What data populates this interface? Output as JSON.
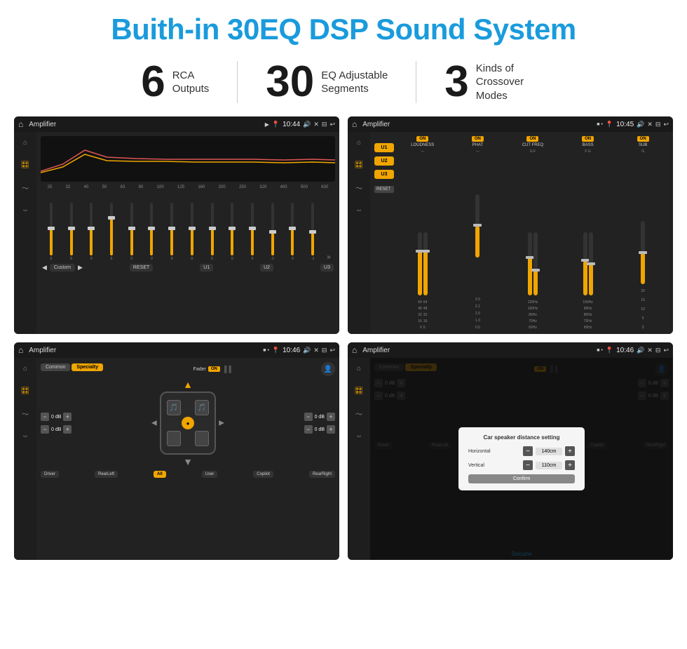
{
  "header": {
    "title": "Buith-in 30EQ DSP Sound System"
  },
  "stats": [
    {
      "number": "6",
      "label": "RCA\nOutputs"
    },
    {
      "number": "30",
      "label": "EQ Adjustable\nSegments"
    },
    {
      "number": "3",
      "label": "Kinds of\nCrossover Modes"
    }
  ],
  "screens": {
    "screen1": {
      "title": "Amplifier",
      "time": "10:44",
      "eq_freqs": [
        "25",
        "32",
        "40",
        "50",
        "63",
        "80",
        "100",
        "125",
        "160",
        "200",
        "250",
        "320",
        "400",
        "500",
        "630"
      ],
      "eq_values": [
        "0",
        "0",
        "0",
        "5",
        "0",
        "0",
        "0",
        "0",
        "0",
        "0",
        "0",
        "-1",
        "0",
        "-1"
      ],
      "buttons": [
        "Custom",
        "RESET",
        "U1",
        "U2",
        "U3"
      ]
    },
    "screen2": {
      "title": "Amplifier",
      "time": "10:45",
      "presets": [
        "U1",
        "U2",
        "U3"
      ],
      "channels": [
        "LOUDNESS",
        "PHAT",
        "CUT FREQ",
        "BASS",
        "SUB"
      ]
    },
    "screen3": {
      "title": "Amplifier",
      "time": "10:46",
      "tabs": [
        "Common",
        "Specialty"
      ],
      "fader": "Fader",
      "on": "ON",
      "bottom_btns": [
        "Driver",
        "RearLeft",
        "All",
        "User",
        "Copilot",
        "RearRight"
      ]
    },
    "screen4": {
      "title": "Amplifier",
      "time": "10:46",
      "dialog": {
        "title": "Car speaker distance setting",
        "horizontal_label": "Horizontal",
        "horizontal_value": "140cm",
        "vertical_label": "Vertical",
        "vertical_value": "110cm",
        "confirm": "Confirm"
      },
      "bottom_btns": [
        "Driver",
        "RearLeft",
        "All",
        "User",
        "Copilot",
        "RearRight"
      ]
    }
  },
  "watermark": "Seicane"
}
